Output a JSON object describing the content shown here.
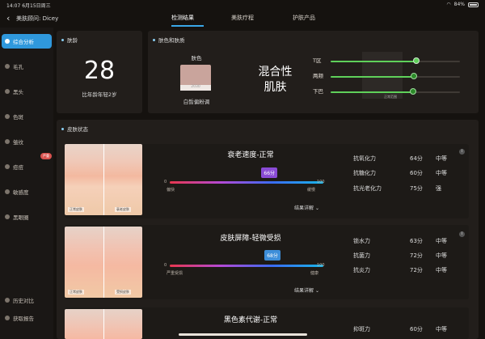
{
  "status": {
    "time": "14:07",
    "date": "6月15日周三",
    "battery": "84%"
  },
  "header": {
    "advisor": "美肤顾问: Dicey",
    "tabs": [
      "检测结果",
      "美肤疗程",
      "护肤产品"
    ]
  },
  "sidebar": {
    "items": [
      "综合分析",
      "毛孔",
      "黑头",
      "色斑",
      "皱纹",
      "痘痘",
      "敏感度",
      "黑眼圈"
    ],
    "badge": "严重",
    "bottom": [
      "历史对比",
      "获取报告"
    ]
  },
  "age": {
    "title": "肤龄",
    "value": "28",
    "subtitle": "比年龄年轻2岁"
  },
  "tone": {
    "title": "肤色和肤质",
    "tone_label": "肤色",
    "swatch_code": "2030",
    "swatch_color": "#c9a49c",
    "tone_name": "白皙偏粉调",
    "skin_type": "混合性\n肌肤",
    "zones": [
      "T区",
      "两颊",
      "下巴"
    ],
    "range_label": "正常范围",
    "zone_levels": [
      0.88,
      0.86,
      0.85
    ]
  },
  "status_section": {
    "title": "皮肤状态"
  },
  "cards": [
    {
      "title": "衰老速度-正常",
      "score": "66分",
      "min": "0",
      "max": "100",
      "left": "偏快",
      "right": "缓慢",
      "img_left": "正常皮肤",
      "img_right": "衰老皮肤",
      "link": "结果详解",
      "metrics": [
        [
          "抗氧化力",
          "64分",
          "中等"
        ],
        [
          "抗糖化力",
          "60分",
          "中等"
        ],
        [
          "抗光老化力",
          "75分",
          "强"
        ]
      ],
      "level": 0.66
    },
    {
      "title": "皮肤屏障-轻微受损",
      "score": "68分",
      "min": "0",
      "max": "100",
      "left": "严重受损",
      "right": "健康",
      "img_left": "正常皮肤",
      "img_right": "受损皮肤",
      "link": "结果详解",
      "metrics": [
        [
          "锁水力",
          "63分",
          "中等"
        ],
        [
          "抗菌力",
          "72分",
          "中等"
        ],
        [
          "抗炎力",
          "72分",
          "中等"
        ]
      ],
      "level": 0.68
    },
    {
      "title": "黑色素代谢-正常",
      "score": "",
      "metrics": [
        [
          "抑斑力",
          "60分",
          "中等"
        ]
      ]
    }
  ],
  "colors": {
    "accent": "#2f98dc",
    "green": "#5fd05a"
  }
}
